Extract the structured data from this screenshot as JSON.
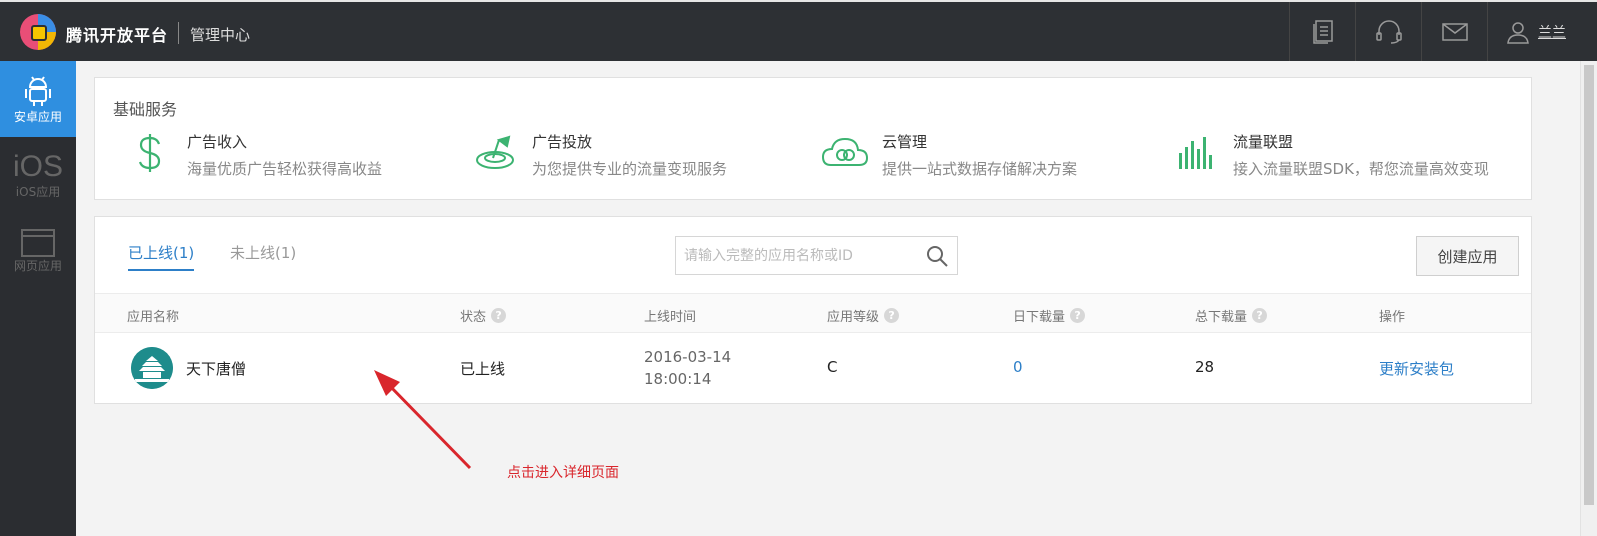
{
  "header": {
    "brand": "腾讯开放平台",
    "subtitle": "管理中心",
    "user_name": "兰兰",
    "icons": [
      "document-icon",
      "headset-icon",
      "mail-icon",
      "user-icon"
    ]
  },
  "sidebar": {
    "items": [
      {
        "label": "安卓应用",
        "icon": "android-icon",
        "active": true
      },
      {
        "label": "iOS应用",
        "icon": "ios-icon",
        "glyph": "iOS",
        "active": false
      },
      {
        "label": "网页应用",
        "icon": "browser-window-icon",
        "active": false
      }
    ]
  },
  "basic_services": {
    "title": "基础服务",
    "items": [
      {
        "name": "广告收入",
        "desc": "海量优质广告轻松获得高收益",
        "icon": "dollar-icon"
      },
      {
        "name": "广告投放",
        "desc": "为您提供专业的流量变现服务",
        "icon": "target-icon"
      },
      {
        "name": "云管理",
        "desc": "提供一站式数据存储解决方案",
        "icon": "cloud-icon"
      },
      {
        "name": "流量联盟",
        "desc": "接入流量联盟SDK，帮您流量高效变现",
        "icon": "bar-chart-icon"
      }
    ]
  },
  "apps": {
    "tabs": {
      "online": "已上线(1)",
      "offline": "未上线(1)"
    },
    "search_placeholder": "请输入完整的应用名称或ID",
    "create_label": "创建应用",
    "columns": {
      "name": "应用名称",
      "status": "状态",
      "online_time": "上线时间",
      "level": "应用等级",
      "daily_downloads": "日下载量",
      "total_downloads": "总下载量",
      "actions": "操作"
    },
    "help_mark": "?",
    "rows": [
      {
        "name": "天下唐僧",
        "status": "已上线",
        "date": "2016-03-14",
        "time": "18:00:14",
        "level": "C",
        "daily_downloads": "0",
        "total_downloads": "28",
        "action": "更新安装包"
      }
    ]
  },
  "annotation": {
    "text": "点击进入详细页面",
    "color": "#d9262c"
  },
  "colors": {
    "accent": "#2f8fe0",
    "link": "#2d7fc8",
    "service_green": "#3cb371",
    "topbar": "#2d3034",
    "sidebar": "#2b2d31"
  }
}
